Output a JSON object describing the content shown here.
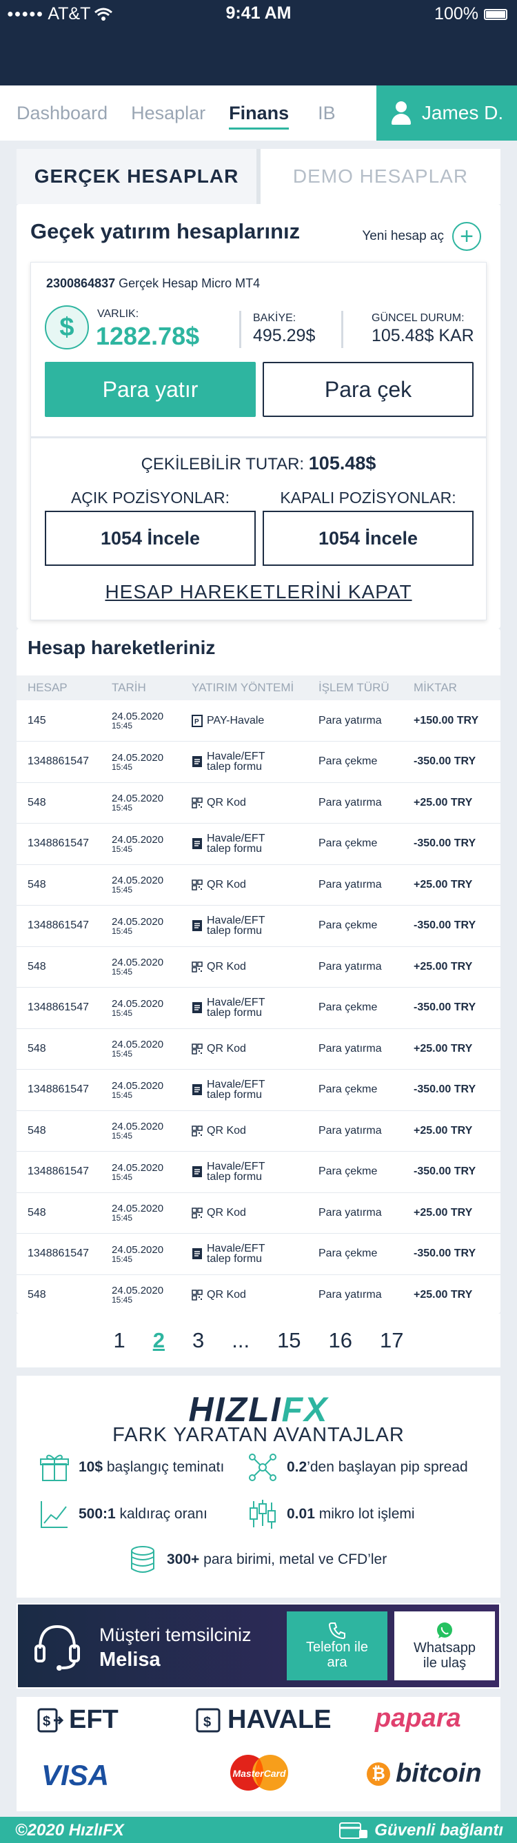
{
  "status_bar": {
    "carrier": "AT&T",
    "time": "9:41 AM",
    "battery": "100%"
  },
  "nav": {
    "tabs": [
      {
        "label": "Dashboard"
      },
      {
        "label": "Hesaplar"
      },
      {
        "label": "Finans"
      },
      {
        "label": "IB"
      }
    ],
    "active_tab": "Finans",
    "user_name": "James D."
  },
  "account_tabs": {
    "real": "GERÇEK HESAPLAR",
    "demo": "DEMO HESAPLAR"
  },
  "accounts_section": {
    "title": "Geçek yatırım hesaplarınız",
    "new_account": "Yeni hesap aç"
  },
  "account": {
    "number": "2300864837",
    "type": "Gerçek Hesap Micro MT4",
    "varlik_label": "VARLIK:",
    "varlik_value": "1282.78$",
    "bakiye_label": "BAKİYE:",
    "bakiye_value": "495.29$",
    "guncel_label": "GÜNCEL DURUM:",
    "guncel_value": "105.48$ KAR",
    "deposit_label": "Para yatır",
    "withdraw_label": "Para çek",
    "cekilebilir_label": "ÇEKİLEBİLİR TUTAR:",
    "cekilebilir_value": "105.48$",
    "open_positions_label": "AÇIK POZİSYONLAR:",
    "open_positions_button": "1054 İncele",
    "closed_positions_label": "KAPALI POZİSYONLAR:",
    "closed_positions_button": "1054 İncele",
    "close_movements_label": "HESAP HAREKETLERİNİ KAPAT"
  },
  "transactions": {
    "title": "Hesap hareketleriniz",
    "columns": [
      "HESAP",
      "TARİH",
      "YATIRIM YÖNTEMİ",
      "İŞLEM TÜRÜ",
      "MİKTAR"
    ],
    "rows": [
      {
        "account": "145",
        "date": "24.05.2020",
        "time": "15:45",
        "method": "PAY-Havale",
        "method2": "",
        "icon": "pay-icon",
        "type": "Para yatırma",
        "amount": "+150.00 TRY"
      },
      {
        "account": "1348861547",
        "date": "24.05.2020",
        "time": "15:45",
        "method": "Havale/EFT",
        "method2": "talep formu",
        "icon": "form-icon",
        "type": "Para çekme",
        "amount": "-350.00 TRY"
      },
      {
        "account": "548",
        "date": "24.05.2020",
        "time": "15:45",
        "method": "QR Kod",
        "method2": "",
        "icon": "qr-icon",
        "type": "Para yatırma",
        "amount": "+25.00 TRY"
      },
      {
        "account": "1348861547",
        "date": "24.05.2020",
        "time": "15:45",
        "method": "Havale/EFT",
        "method2": "talep formu",
        "icon": "form-icon",
        "type": "Para çekme",
        "amount": "-350.00 TRY"
      },
      {
        "account": "548",
        "date": "24.05.2020",
        "time": "15:45",
        "method": "QR Kod",
        "method2": "",
        "icon": "qr-icon",
        "type": "Para yatırma",
        "amount": "+25.00 TRY"
      },
      {
        "account": "1348861547",
        "date": "24.05.2020",
        "time": "15:45",
        "method": "Havale/EFT",
        "method2": "talep formu",
        "icon": "form-icon",
        "type": "Para çekme",
        "amount": "-350.00 TRY"
      },
      {
        "account": "548",
        "date": "24.05.2020",
        "time": "15:45",
        "method": "QR Kod",
        "method2": "",
        "icon": "qr-icon",
        "type": "Para yatırma",
        "amount": "+25.00 TRY"
      },
      {
        "account": "1348861547",
        "date": "24.05.2020",
        "time": "15:45",
        "method": "Havale/EFT",
        "method2": "talep formu",
        "icon": "form-icon",
        "type": "Para çekme",
        "amount": "-350.00 TRY"
      },
      {
        "account": "548",
        "date": "24.05.2020",
        "time": "15:45",
        "method": "QR Kod",
        "method2": "",
        "icon": "qr-icon",
        "type": "Para yatırma",
        "amount": "+25.00 TRY"
      },
      {
        "account": "1348861547",
        "date": "24.05.2020",
        "time": "15:45",
        "method": "Havale/EFT",
        "method2": "talep formu",
        "icon": "form-icon",
        "type": "Para çekme",
        "amount": "-350.00 TRY"
      },
      {
        "account": "548",
        "date": "24.05.2020",
        "time": "15:45",
        "method": "QR Kod",
        "method2": "",
        "icon": "qr-icon",
        "type": "Para yatırma",
        "amount": "+25.00 TRY"
      },
      {
        "account": "1348861547",
        "date": "24.05.2020",
        "time": "15:45",
        "method": "Havale/EFT",
        "method2": "talep formu",
        "icon": "form-icon",
        "type": "Para çekme",
        "amount": "-350.00 TRY"
      },
      {
        "account": "548",
        "date": "24.05.2020",
        "time": "15:45",
        "method": "QR Kod",
        "method2": "",
        "icon": "qr-icon",
        "type": "Para yatırma",
        "amount": "+25.00 TRY"
      },
      {
        "account": "1348861547",
        "date": "24.05.2020",
        "time": "15:45",
        "method": "Havale/EFT",
        "method2": "talep formu",
        "icon": "form-icon",
        "type": "Para çekme",
        "amount": "-350.00 TRY"
      },
      {
        "account": "548",
        "date": "24.05.2020",
        "time": "15:45",
        "method": "QR Kod",
        "method2": "",
        "icon": "qr-icon",
        "type": "Para yatırma",
        "amount": "+25.00 TRY"
      }
    ]
  },
  "pagination": {
    "pages": [
      "1",
      "2",
      "3",
      "...",
      "15",
      "16",
      "17"
    ],
    "current": "2"
  },
  "advantages": {
    "logo_a": "HIZLI",
    "logo_b": "FX",
    "title": "FARK YARATAN AVANTAJLAR",
    "items": [
      {
        "bold": "10$",
        "text": " başlangıç teminatı"
      },
      {
        "bold": "0.2",
        "text": "’den başlayan pip spread"
      },
      {
        "bold": "500:1",
        "text": " kaldıraç oranı"
      },
      {
        "bold": "0.01",
        "text": " mikro lot işlemi"
      },
      {
        "bold": "300+",
        "text": " para birimi, metal ve CFD’ler"
      }
    ]
  },
  "representative": {
    "label": "Müşteri temsilciniz",
    "name": "Melisa",
    "call_line1": "Telefon ile",
    "call_line2": "ara",
    "whatsapp_line1": "Whatsapp",
    "whatsapp_line2": "ile ulaş"
  },
  "payments": {
    "eft": "EFT",
    "havale": "HAVALE",
    "papara": "papara",
    "visa": "VISA",
    "mastercard": "MasterCard",
    "bitcoin": "bitcoin"
  },
  "footer": {
    "copyright": "©2020 HızlıFX",
    "secure": "Güvenli bağlantı"
  },
  "colors": {
    "teal": "#2eb5a0",
    "navy": "#1a2b45"
  }
}
